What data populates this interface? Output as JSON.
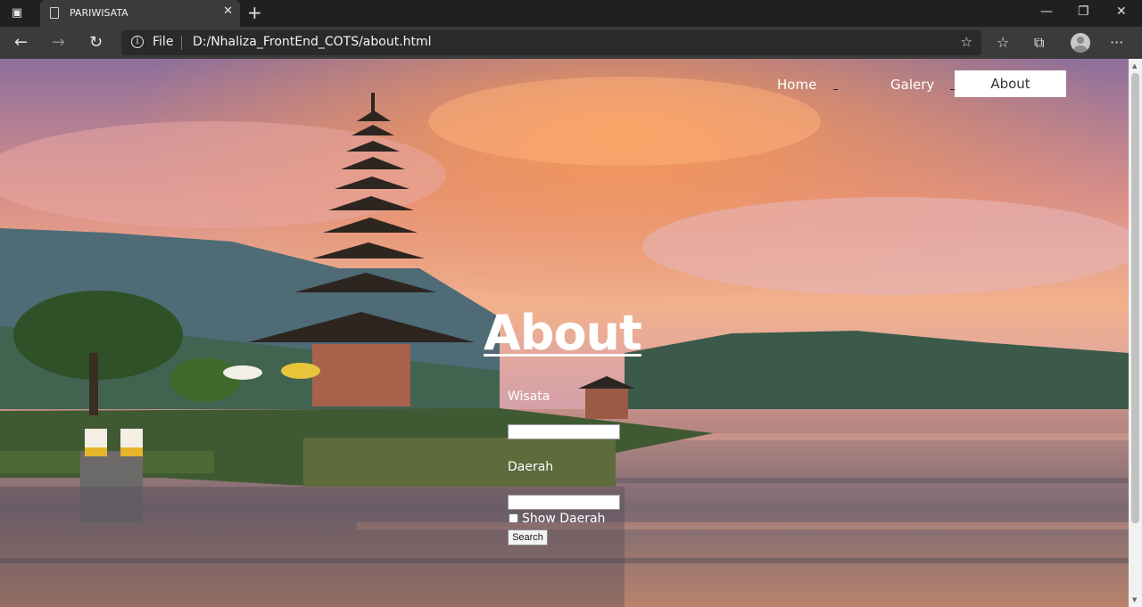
{
  "browser": {
    "tab_title": "PARIWISATA",
    "tab_close": "✕",
    "new_tab": "+",
    "minimize": "—",
    "maximize": "❐",
    "close": "✕",
    "back": "←",
    "forward": "→",
    "reload": "↻",
    "info_glyph": "i",
    "scheme_label": "File",
    "url": "D:/Nhaliza_FrontEnd_COTS/about.html",
    "favorite_star": "☆",
    "favorites": "☆",
    "collections": "⧉",
    "menu": "···"
  },
  "nav": {
    "home": "Home",
    "galery": "Galery",
    "about": "About"
  },
  "page": {
    "title": "About",
    "wisata_label": "Wisata",
    "daerah_label": "Daerah",
    "wisata_value": "",
    "daerah_value": "",
    "show_daerah_label": "Show Daerah",
    "show_daerah_checked": false,
    "search_button": "Search"
  },
  "icons": {
    "tab_actions": "tab-actions-icon",
    "page": "page-icon",
    "info": "info-icon",
    "profile": "profile-avatar"
  },
  "colors": {
    "nav_active_bg": "#ffffff",
    "text": "#ffffff"
  }
}
